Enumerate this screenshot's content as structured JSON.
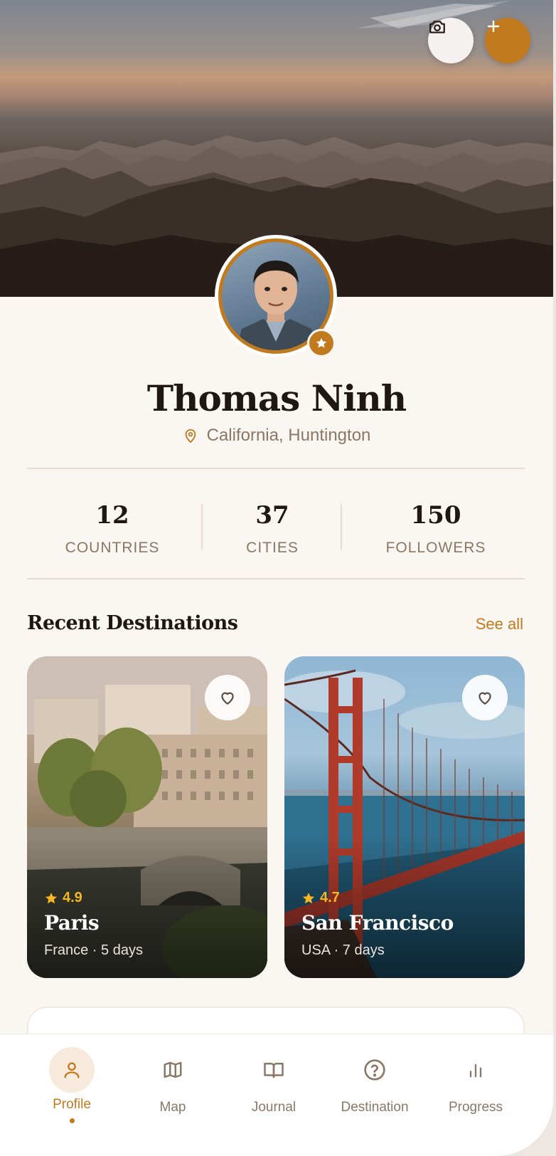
{
  "header": {
    "camera_icon": "camera-icon",
    "add_icon": "plus-icon"
  },
  "profile": {
    "name": "Thomas Ninh",
    "location": "California, Huntington",
    "badge_icon": "star-icon"
  },
  "stats": [
    {
      "value": "12",
      "label": "COUNTRIES"
    },
    {
      "value": "37",
      "label": "CITIES"
    },
    {
      "value": "150",
      "label": "FOLLOWERS"
    }
  ],
  "recent": {
    "title": "Recent Destinations",
    "see_all": "See all",
    "cards": [
      {
        "rating": "4.9",
        "title": "Paris",
        "subtitle": "France · 5 days"
      },
      {
        "rating": "4.7",
        "title": "San Francisco",
        "subtitle": "USA · 7 days"
      }
    ]
  },
  "nav": {
    "items": [
      {
        "label": "Profile",
        "icon": "user-icon",
        "active": true
      },
      {
        "label": "Map",
        "icon": "map-icon",
        "active": false
      },
      {
        "label": "Journal",
        "icon": "book-icon",
        "active": false
      },
      {
        "label": "Destination",
        "icon": "help-circle-icon",
        "active": false
      },
      {
        "label": "Progress",
        "icon": "bar-chart-icon",
        "active": false
      }
    ]
  },
  "colors": {
    "accent": "#c27a1f",
    "background": "#faf6f1",
    "text_primary": "#1e1713",
    "text_secondary": "#8a7767",
    "star": "#f5b623"
  }
}
